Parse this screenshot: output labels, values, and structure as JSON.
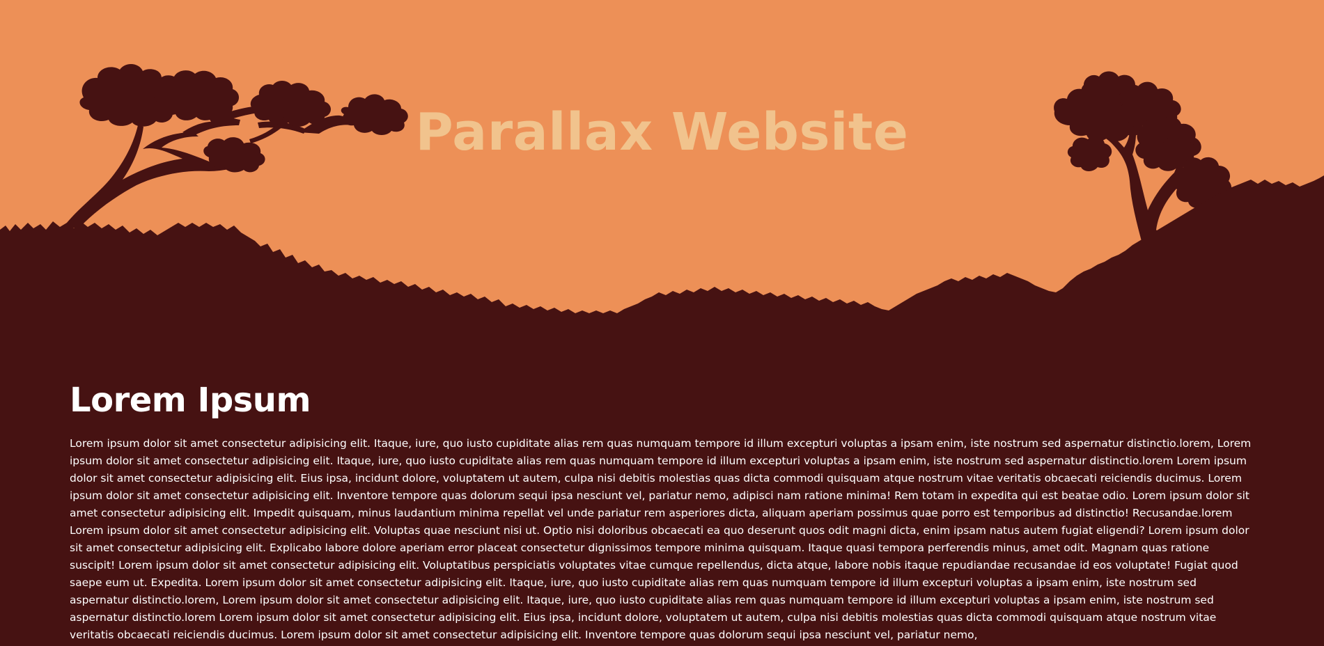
{
  "colors": {
    "sky": "#ed9057",
    "silhouette": "#461212",
    "hero_title": "#f1c38d",
    "text": "#ffffff"
  },
  "hero": {
    "title": "Parallax Website"
  },
  "section": {
    "heading": "Lorem Ipsum",
    "body": "Lorem ipsum dolor sit amet consectetur adipisicing elit. Itaque, iure, quo iusto cupiditate alias rem quas numquam tempore id illum excepturi voluptas a ipsam enim, iste nostrum sed aspernatur distinctio.lorem, Lorem ipsum dolor sit amet consectetur adipisicing elit. Itaque, iure, quo iusto cupiditate alias rem quas numquam tempore id illum excepturi voluptas a ipsam enim, iste nostrum sed aspernatur distinctio.lorem Lorem ipsum dolor sit amet consectetur adipisicing elit. Eius ipsa, incidunt dolore, voluptatem ut autem, culpa nisi debitis molestias quas dicta commodi quisquam atque nostrum vitae veritatis obcaecati reiciendis ducimus. Lorem ipsum dolor sit amet consectetur adipisicing elit. Inventore tempore quas dolorum sequi ipsa nesciunt vel, pariatur nemo, adipisci nam ratione minima! Rem totam in expedita qui est beatae odio. Lorem ipsum dolor sit amet consectetur adipisicing elit. Impedit quisquam, minus laudantium minima repellat vel unde pariatur rem asperiores dicta, aliquam aperiam possimus quae porro est temporibus ad distinctio! Recusandae.lorem Lorem ipsum dolor sit amet consectetur adipisicing elit. Voluptas quae nesciunt nisi ut. Optio nisi doloribus obcaecati ea quo deserunt quos odit magni dicta, enim ipsam natus autem fugiat eligendi? Lorem ipsum dolor sit amet consectetur adipisicing elit. Explicabo labore dolore aperiam error placeat consectetur dignissimos tempore minima quisquam. Itaque quasi tempora perferendis minus, amet odit. Magnam quas ratione suscipit! Lorem ipsum dolor sit amet consectetur adipisicing elit. Voluptatibus perspiciatis voluptates vitae cumque repellendus, dicta atque, labore nobis itaque repudiandae recusandae id eos voluptate! Fugiat quod saepe eum ut. Expedita. Lorem ipsum dolor sit amet consectetur adipisicing elit. Itaque, iure, quo iusto cupiditate alias rem quas numquam tempore id illum excepturi voluptas a ipsam enim, iste nostrum sed aspernatur distinctio.lorem, Lorem ipsum dolor sit amet consectetur adipisicing elit. Itaque, iure, quo iusto cupiditate alias rem quas numquam tempore id illum excepturi voluptas a ipsam enim, iste nostrum sed aspernatur distinctio.lorem Lorem ipsum dolor sit amet consectetur adipisicing elit. Eius ipsa, incidunt dolore, voluptatem ut autem, culpa nisi debitis molestias quas dicta commodi quisquam atque nostrum vitae veritatis obcaecati reiciendis ducimus. Lorem ipsum dolor sit amet consectetur adipisicing elit. Inventore tempore quas dolorum sequi ipsa nesciunt vel, pariatur nemo,"
  }
}
